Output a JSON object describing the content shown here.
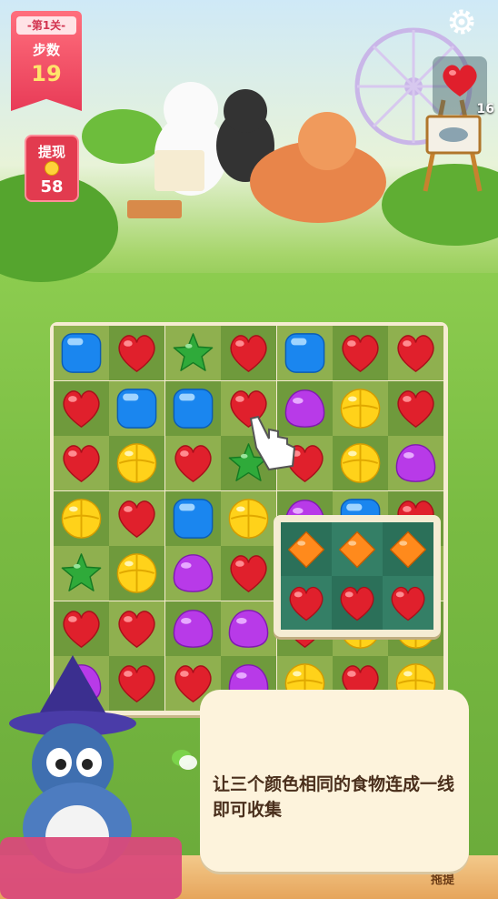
{
  "level": {
    "label": "-第1关-",
    "steps_label": "步数",
    "steps": "19"
  },
  "cash": {
    "label": "提现",
    "value": "58"
  },
  "target": {
    "item": "heart-icon",
    "count": "16"
  },
  "settings": {
    "icon": "gear-icon"
  },
  "board": {
    "rows": [
      [
        "blue",
        "heart",
        "star",
        "heart",
        "blue",
        "heart",
        "heart"
      ],
      [
        "heart",
        "blue",
        "blue",
        "heart",
        "purple",
        "yellow",
        "heart"
      ],
      [
        "heart",
        "yellow",
        "heart",
        "star",
        "heart",
        "yellow",
        "purple"
      ],
      [
        "yellow",
        "heart",
        "blue",
        "yellow",
        "purple",
        "blue",
        "heart"
      ],
      [
        "star",
        "yellow",
        "purple",
        "heart",
        "",
        "",
        ""
      ],
      [
        "heart",
        "heart",
        "purple",
        "purple",
        "heart",
        "yellow",
        "yellow"
      ],
      [
        "purple",
        "heart",
        "heart",
        "purple",
        "yellow",
        "heart",
        "yellow"
      ]
    ]
  },
  "tutorial_popup": {
    "rows": [
      [
        "orange",
        "orange",
        "orange"
      ],
      [
        "heart",
        "heart",
        "heart"
      ]
    ]
  },
  "hint": {
    "text": "让三个颜色相同的食物连成一线即可收集"
  },
  "bottom": {
    "left_label": "",
    "mid_label": "",
    "right_label": "拖提"
  },
  "colors": {
    "banner": "#e83b57",
    "board_bg": "#f6ecd2",
    "cell_dark": "#6f9a3c",
    "cell_light": "#8fb04f",
    "bubble": "#fdf3dc"
  }
}
